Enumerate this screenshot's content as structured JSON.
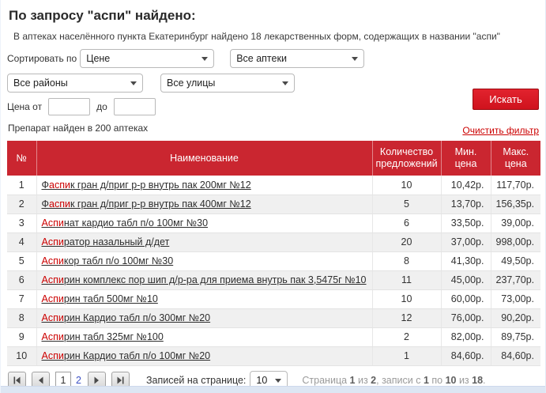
{
  "page": {
    "title": "По запросу \"аспи\" найдено:",
    "subtitle": "В аптеках населённого пункта Екатеринбург найдено 18 лекарственных форм, содержащих в названии \"аспи\""
  },
  "filters": {
    "sort_label": "Сортировать по",
    "sort_value": "Цене",
    "pharmacy_value": "Все аптеки",
    "district_value": "Все районы",
    "street_value": "Все улицы",
    "price_from_label": "Цена от",
    "price_to_label": "до",
    "price_from_value": "",
    "price_to_value": "",
    "search_button_label": "Искать",
    "found_text": "Препарат найден в 200 аптеках",
    "clear_link_label": "Очистить фильтр"
  },
  "colors": {
    "header_red": "#ca2630",
    "button_red": "#cf121d",
    "match_red": "#cc0000",
    "page_link_blue": "#3d52c5"
  },
  "table": {
    "headers": {
      "num": "№",
      "name": "Наименование",
      "offers": "Количество предложений",
      "min": "Мин. цена",
      "max": "Макс. цена"
    },
    "rows": [
      {
        "num": "1",
        "pre": "Ф",
        "match": "аспи",
        "post": "к гран д/приг р-р внутрь пак 200мг №12",
        "offers": "10",
        "min": "10,42р.",
        "max": "117,70р."
      },
      {
        "num": "2",
        "pre": "Ф",
        "match": "аспи",
        "post": "к гран д/приг р-р внутрь пак 400мг №12",
        "offers": "5",
        "min": "13,70р.",
        "max": "156,35р."
      },
      {
        "num": "3",
        "pre": "",
        "match": "Аспи",
        "post": "нат кардио табл п/о 100мг №30",
        "offers": "6",
        "min": "33,50р.",
        "max": "39,00р."
      },
      {
        "num": "4",
        "pre": "",
        "match": "Аспи",
        "post": "ратор назальный д/дет",
        "offers": "20",
        "min": "37,00р.",
        "max": "998,00р."
      },
      {
        "num": "5",
        "pre": "",
        "match": "Аспи",
        "post": "кор табл п/о 100мг №30",
        "offers": "8",
        "min": "41,30р.",
        "max": "49,50р."
      },
      {
        "num": "6",
        "pre": "",
        "match": "Аспи",
        "post": "рин комплекс пор шип д/р-ра для приема внутрь пак 3,5475г №10",
        "offers": "11",
        "min": "45,00р.",
        "max": "237,70р."
      },
      {
        "num": "7",
        "pre": "",
        "match": "Аспи",
        "post": "рин табл 500мг №10",
        "offers": "10",
        "min": "60,00р.",
        "max": "73,00р."
      },
      {
        "num": "8",
        "pre": "",
        "match": "Аспи",
        "post": "рин Кардио табл п/о 300мг №20",
        "offers": "12",
        "min": "76,00р.",
        "max": "90,20р."
      },
      {
        "num": "9",
        "pre": "",
        "match": "Аспи",
        "post": "рин табл 325мг №100",
        "offers": "2",
        "min": "82,00р.",
        "max": "89,75р."
      },
      {
        "num": "10",
        "pre": "",
        "match": "Аспи",
        "post": "рин Кардио табл п/о 100мг №20",
        "offers": "1",
        "min": "84,60р.",
        "max": "84,60р."
      }
    ]
  },
  "pagination": {
    "current_page": "1",
    "other_page": "2",
    "per_page_label": "Записей на странице:",
    "per_page_value": "10",
    "status_parts": [
      {
        "text": "Страница ",
        "bold": false
      },
      {
        "text": "1",
        "bold": true
      },
      {
        "text": " из ",
        "bold": false
      },
      {
        "text": "2",
        "bold": true
      },
      {
        "text": ", записи с ",
        "bold": false
      },
      {
        "text": "1",
        "bold": true
      },
      {
        "text": " по ",
        "bold": false
      },
      {
        "text": "10",
        "bold": true
      },
      {
        "text": " из ",
        "bold": false
      },
      {
        "text": "18",
        "bold": true
      },
      {
        "text": ".",
        "bold": false
      }
    ]
  }
}
